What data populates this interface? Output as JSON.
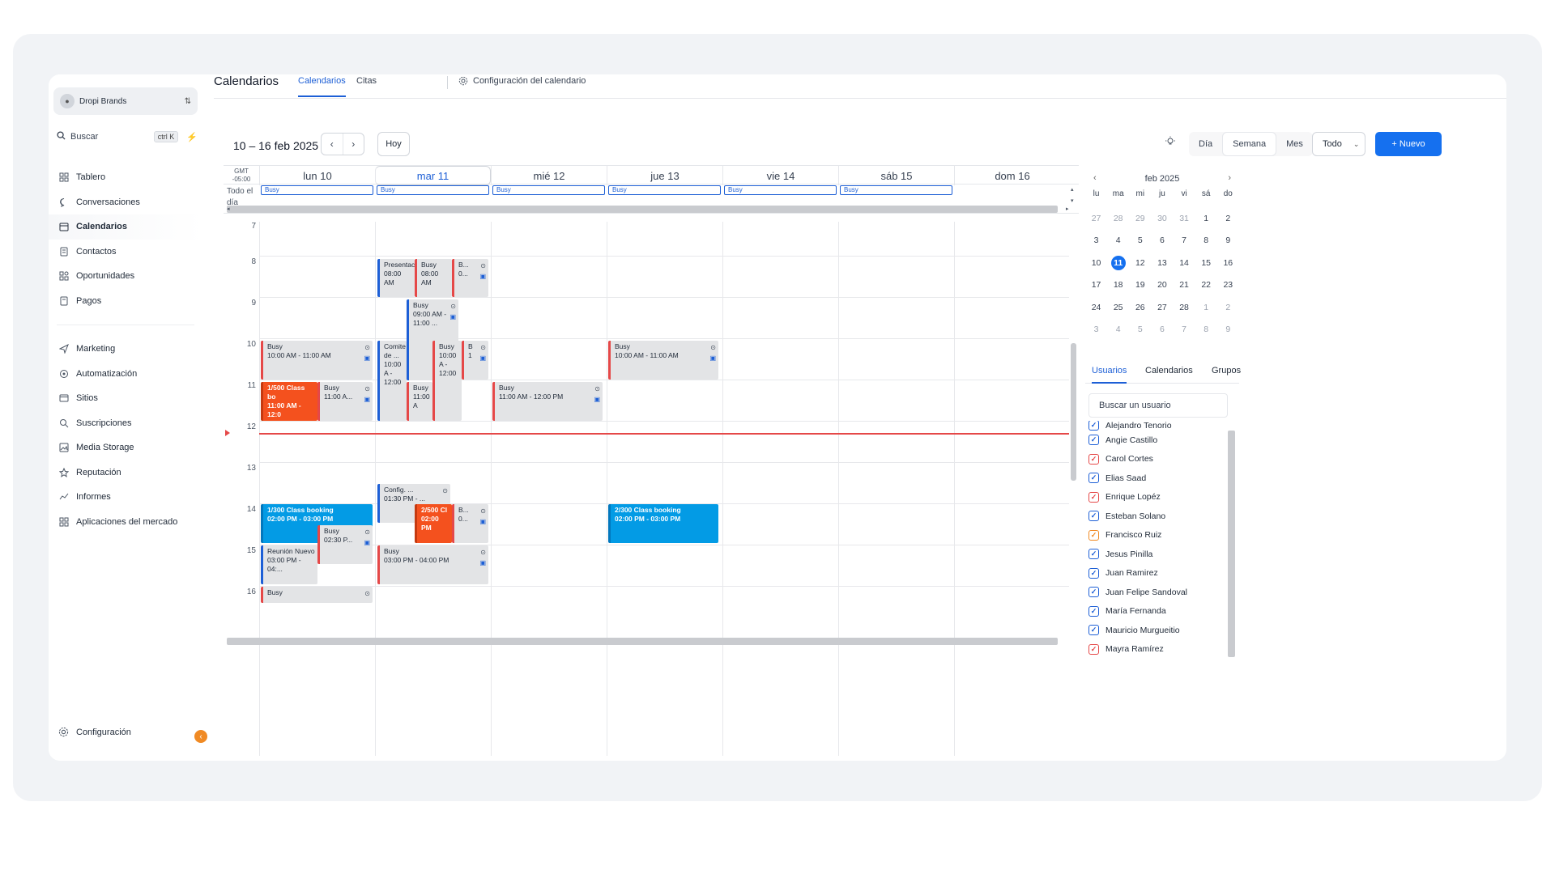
{
  "sidebar": {
    "account": "Dropi Brands",
    "search_label": "Buscar",
    "search_shortcut": "ctrl K",
    "items": [
      {
        "label": "Tablero",
        "icon": "dashboard-icon"
      },
      {
        "label": "Conversaciones",
        "icon": "chat-icon"
      },
      {
        "label": "Calendarios",
        "icon": "calendar-icon"
      },
      {
        "label": "Contactos",
        "icon": "contacts-icon"
      },
      {
        "label": "Oportunidades",
        "icon": "opportunities-icon"
      },
      {
        "label": "Pagos",
        "icon": "payments-icon"
      }
    ],
    "items2": [
      {
        "label": "Marketing",
        "icon": "send-icon"
      },
      {
        "label": "Automatización",
        "icon": "automation-icon"
      },
      {
        "label": "Sitios",
        "icon": "sites-icon"
      },
      {
        "label": "Suscripciones",
        "icon": "subscriptions-icon"
      },
      {
        "label": "Media Storage",
        "icon": "media-icon"
      },
      {
        "label": "Reputación",
        "icon": "star-icon"
      },
      {
        "label": "Informes",
        "icon": "chart-icon"
      },
      {
        "label": "Aplicaciones del mercado",
        "icon": "apps-icon"
      }
    ],
    "settings_label": "Configuración"
  },
  "header": {
    "title": "Calendarios",
    "tabs": [
      "Calendarios",
      "Citas",
      "Configuración del calendario"
    ]
  },
  "toolbar": {
    "range": "10 – 16 feb 2025",
    "today": "Hoy",
    "views": [
      "Día",
      "Semana",
      "Mes"
    ],
    "filter": "Todo",
    "new_button": "+ Nuevo"
  },
  "grid": {
    "gmt": "GMT\n-05:00",
    "allday_label": "Todo el día",
    "days": [
      "lun 10",
      "mar 11",
      "mié 12",
      "jue 13",
      "vie 14",
      "sáb 15",
      "dom 16"
    ],
    "allday_events": [
      "Busy",
      "Busy",
      "Busy",
      "Busy",
      "Busy",
      "Busy"
    ],
    "hours": [
      "7",
      "8",
      "9",
      "10",
      "11",
      "12",
      "13",
      "14",
      "15",
      "16"
    ]
  },
  "events": [
    {
      "title": "Presentac",
      "time": "08:00 AM"
    },
    {
      "title": "Busy",
      "time": "08:00 AM"
    },
    {
      "title": "B...",
      "time": "0..."
    },
    {
      "title": "Busy",
      "time": "09:00 AM - 11:00 ..."
    },
    {
      "title": "Busy",
      "time": "10:00 AM - 11:00 AM"
    },
    {
      "title": "Comite de ...",
      "time": "10:00 A - 12:00"
    },
    {
      "title": "Busy",
      "time": "10:00 A - 12:00"
    },
    {
      "title": "B",
      "time": "1"
    },
    {
      "title": "Busy",
      "time": "10:00 AM - 11:00 AM"
    },
    {
      "title": "1/500 Class bo",
      "time": "11:00 AM - 12:0"
    },
    {
      "title": "Busy",
      "time": "11:00 A..."
    },
    {
      "title": "Busy",
      "time": "11:00 A"
    },
    {
      "title": "Busy",
      "time": "11:00 AM - 12:00 PM"
    },
    {
      "title": "Config. ...",
      "time": "01:30 PM - ..."
    },
    {
      "title": "1/300 Class booking",
      "time": "02:00 PM - 03:00 PM"
    },
    {
      "title": "2/500 Cl",
      "time": "02:00 PM"
    },
    {
      "title": "B...",
      "time": "0..."
    },
    {
      "title": "2/300 Class booking",
      "time": "02:00 PM - 03:00 PM"
    },
    {
      "title": "Busy",
      "time": "02:30 P..."
    },
    {
      "title": "Reunión Nuevo",
      "time": "03:00 PM - 04:..."
    },
    {
      "title": "Busy",
      "time": "03:00 PM - 04:00 PM"
    },
    {
      "title": "Busy",
      "time": ""
    }
  ],
  "mini_calendar": {
    "title": "feb 2025",
    "weekdays": [
      "lu",
      "ma",
      "mi",
      "ju",
      "vi",
      "sá",
      "do"
    ],
    "rows": [
      [
        "27",
        "28",
        "29",
        "30",
        "31",
        "1",
        "2"
      ],
      [
        "3",
        "4",
        "5",
        "6",
        "7",
        "8",
        "9"
      ],
      [
        "10",
        "11",
        "12",
        "13",
        "14",
        "15",
        "16"
      ],
      [
        "17",
        "18",
        "19",
        "20",
        "21",
        "22",
        "23"
      ],
      [
        "24",
        "25",
        "26",
        "27",
        "28",
        "1",
        "2"
      ],
      [
        "3",
        "4",
        "5",
        "6",
        "7",
        "8",
        "9"
      ]
    ],
    "selected": "11"
  },
  "right_tabs": [
    "Usuarios",
    "Calendarios",
    "Grupos"
  ],
  "user_search_placeholder": "Buscar un usuario",
  "users": [
    {
      "name": "Alejandro Tenorio",
      "color": "#1d5fd6"
    },
    {
      "name": "Angie Castillo",
      "color": "#1d5fd6"
    },
    {
      "name": "Carol Cortes",
      "color": "#e54848"
    },
    {
      "name": "Elias Saad",
      "color": "#1d5fd6"
    },
    {
      "name": "Enrique Lopéz",
      "color": "#e54848"
    },
    {
      "name": "Esteban Solano",
      "color": "#1d5fd6"
    },
    {
      "name": "Francisco Ruiz",
      "color": "#f08a24"
    },
    {
      "name": "Jesus Pinilla",
      "color": "#1d5fd6"
    },
    {
      "name": "Juan Ramirez",
      "color": "#1d5fd6"
    },
    {
      "name": "Juan Felipe Sandoval",
      "color": "#1d5fd6"
    },
    {
      "name": "María Fernanda",
      "color": "#1d5fd6"
    },
    {
      "name": "Mauricio Murgueitio",
      "color": "#1d5fd6"
    },
    {
      "name": "Mayra Ramírez",
      "color": "#e54848"
    }
  ]
}
